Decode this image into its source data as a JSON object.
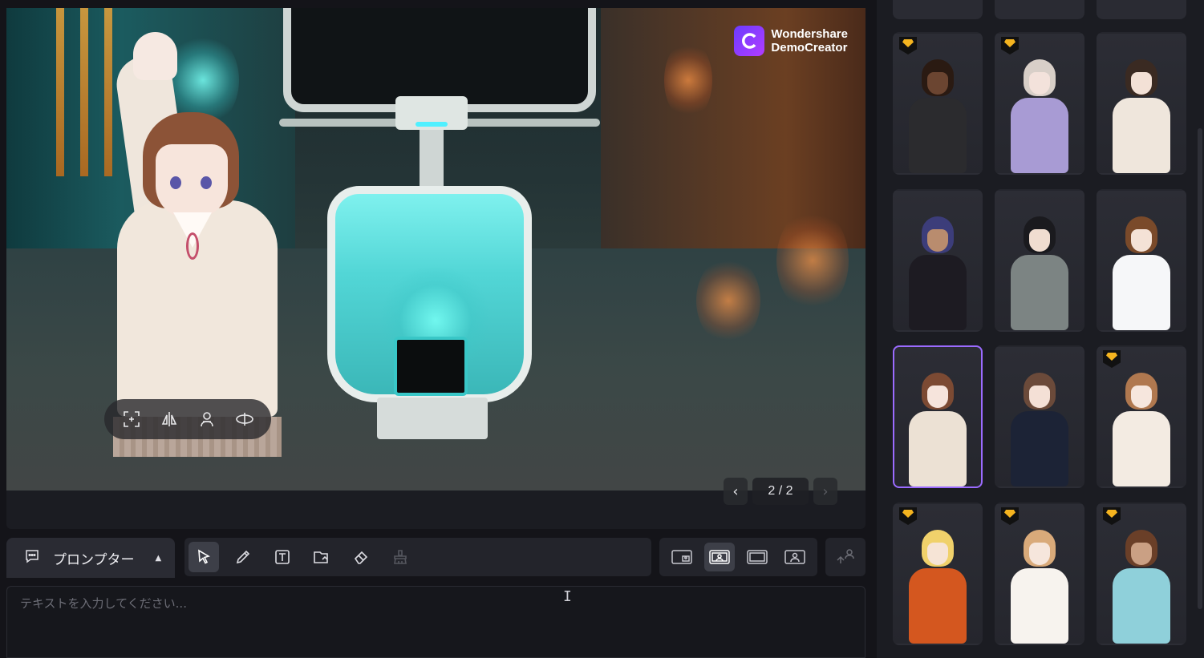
{
  "watermark": {
    "line1": "Wondershare",
    "line2": "DemoCreator"
  },
  "pager": {
    "label": "2 / 2",
    "prev_icon": "chevron-left-icon",
    "next_icon": "chevron-right-icon"
  },
  "avatar_toolbar": {
    "icons": [
      "focus-icon",
      "mirror-icon",
      "person-icon",
      "rotate-icon"
    ]
  },
  "prompter": {
    "label": "プロンプター",
    "caret": "▲"
  },
  "tools": [
    "cursor-icon",
    "pen-icon",
    "text-icon",
    "shape-icon",
    "eraser-icon",
    "clear-icon"
  ],
  "layouts": [
    "layout-pip-icon",
    "layout-avatar-left-icon",
    "layout-screen-icon",
    "layout-avatar-only-icon"
  ],
  "text_input": {
    "placeholder": "テキストを入力してください..."
  },
  "avatars": [
    {
      "name": "avatar-business-man",
      "premium": true
    },
    {
      "name": "avatar-elf-girl",
      "premium": true
    },
    {
      "name": "avatar-cardigan-girl",
      "premium": false
    },
    {
      "name": "avatar-cat-ear-girl",
      "premium": false
    },
    {
      "name": "avatar-hoodie-boy",
      "premium": false
    },
    {
      "name": "avatar-shirt-boy",
      "premium": false
    },
    {
      "name": "avatar-blazer-girl",
      "premium": false,
      "selected": true
    },
    {
      "name": "avatar-uniform-girl",
      "premium": false
    },
    {
      "name": "avatar-ribbon-girl",
      "premium": true
    },
    {
      "name": "avatar-jacket-boy",
      "premium": true
    },
    {
      "name": "avatar-tie-boy",
      "premium": true
    },
    {
      "name": "avatar-dress-girl",
      "premium": true
    }
  ],
  "colors": {
    "accent": "#9b6bff",
    "premium": "#f5b41f",
    "background": "#141419"
  }
}
